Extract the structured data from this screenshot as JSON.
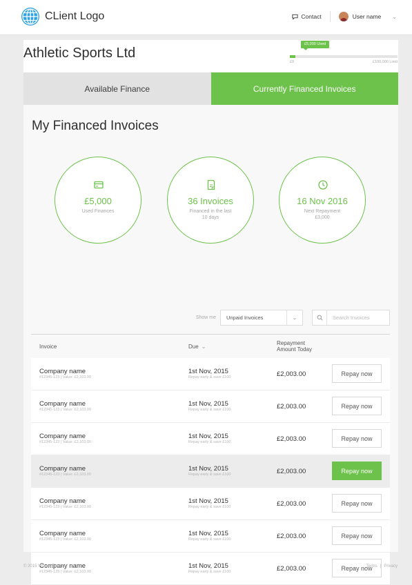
{
  "header": {
    "logo_text": "CLient Logo",
    "contact_label": "Contact",
    "user_name": "User name"
  },
  "account": {
    "company_name": "Athletic Sports Ltd",
    "limit": {
      "used_flag": "£5,000 Used",
      "min_label": "£0",
      "max_label": "£100,000 Limit",
      "used_fraction": 0.05
    }
  },
  "tabs": [
    {
      "label": "Available Finance",
      "active": false
    },
    {
      "label": "Currently Financed Invoices",
      "active": true
    }
  ],
  "page_title": "My Financed Invoices",
  "stats": [
    {
      "icon": "card-icon",
      "value": "£5,000",
      "sub": "Used Finances"
    },
    {
      "icon": "invoice-icon",
      "value": "36 Invoices",
      "sub": "Financed in the last 10 days"
    },
    {
      "icon": "clock-icon",
      "value": "16 Nov 2016",
      "sub": "Next Repayment £3,000"
    }
  ],
  "filters": {
    "show_me_label": "Show me",
    "selected": "Unpaid Invoices",
    "search_placeholder": "Search Invoices"
  },
  "table": {
    "headers": {
      "invoice": "Invoice",
      "due": "Due",
      "repay_line1": "Repayment",
      "repay_line2": "Amount Today"
    },
    "rows": [
      {
        "name": "Company name",
        "ref": "#12345-123 | Value: £2,103.00",
        "due": "1st Nov, 2015",
        "note": "Repay early & save £100",
        "amount": "£2,003.00",
        "button": "Repay now",
        "highlighted": false
      },
      {
        "name": "Company name",
        "ref": "#12345-123 | Value: £2,103.00",
        "due": "1st Nov, 2015",
        "note": "Repay early & save £100",
        "amount": "£2,003.00",
        "button": "Repay now",
        "highlighted": false
      },
      {
        "name": "Company name",
        "ref": "#12345-123 | Value: £2,103.00",
        "due": "1st Nov, 2015",
        "note": "Repay early & save £100",
        "amount": "£2,003.00",
        "button": "Repay now",
        "highlighted": false
      },
      {
        "name": "Company name",
        "ref": "#12345-123 | Value: £2,103.00",
        "due": "1st Nov, 2015",
        "note": "Repay early & save £100",
        "amount": "£2,003.00",
        "button": "Repay now",
        "highlighted": true
      },
      {
        "name": "Company name",
        "ref": "#12345-123 | Value: £2,103.00",
        "due": "1st Nov, 2015",
        "note": "Repay early & save £100",
        "amount": "£2,003.00",
        "button": "Repay now",
        "highlighted": false
      },
      {
        "name": "Company name",
        "ref": "#12345-123 | Value: £2,103.00",
        "due": "1st Nov, 2015",
        "note": "Repay early & save £100",
        "amount": "£2,003.00",
        "button": "Repay now",
        "highlighted": false
      },
      {
        "name": "Company name",
        "ref": "#12345-123 | Value: £2,103.00",
        "due": "1st Nov, 2015",
        "note": "Repay early & save £100",
        "amount": "£2,003.00",
        "button": "Repay now",
        "highlighted": false
      }
    ]
  },
  "footer": {
    "copyright": "© 2015 Virtuus Finance",
    "terms": "Terms",
    "sep": "|",
    "privacy": "Privacy"
  },
  "colors": {
    "accent": "#6cc24a",
    "logo_blue": "#2fa3e0"
  }
}
